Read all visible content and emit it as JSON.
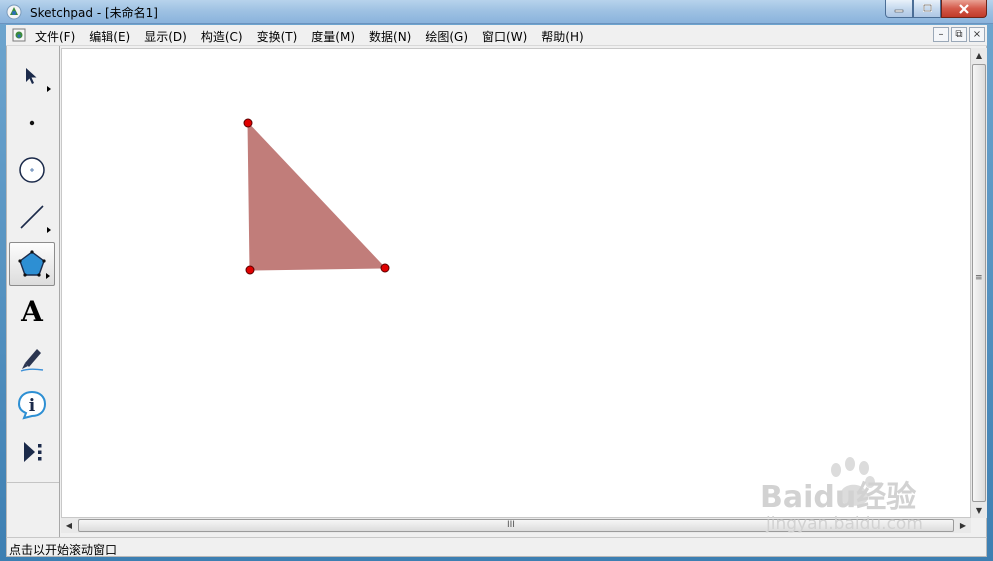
{
  "window": {
    "title": "Sketchpad - [未命名1]",
    "icon": "sketchpad-app-icon"
  },
  "caption_buttons": {
    "minimize": "minimize-icon",
    "maximize": "restore-icon",
    "close": "close-icon"
  },
  "menubar": {
    "items": [
      {
        "label": "文件(F)"
      },
      {
        "label": "编辑(E)"
      },
      {
        "label": "显示(D)"
      },
      {
        "label": "构造(C)"
      },
      {
        "label": "变换(T)"
      },
      {
        "label": "度量(M)"
      },
      {
        "label": "数据(N)"
      },
      {
        "label": "绘图(G)"
      },
      {
        "label": "窗口(W)"
      },
      {
        "label": "帮助(H)"
      }
    ],
    "mdi_buttons": {
      "minimize": "–",
      "restore": "⧉",
      "close": "×"
    }
  },
  "toolbox": {
    "tools": [
      {
        "name": "arrow-select-tool",
        "icon": "arrow-icon",
        "has_submenu": true,
        "active": false
      },
      {
        "name": "point-tool",
        "icon": "point-icon",
        "has_submenu": false,
        "active": false
      },
      {
        "name": "compass-tool",
        "icon": "circle-icon",
        "has_submenu": false,
        "active": false
      },
      {
        "name": "straightedge-tool",
        "icon": "segment-icon",
        "has_submenu": true,
        "active": false
      },
      {
        "name": "polygon-tool",
        "icon": "pentagon-icon",
        "has_submenu": true,
        "active": true
      },
      {
        "name": "text-tool",
        "icon": "text-A-icon",
        "label": "A",
        "has_submenu": false,
        "active": false
      },
      {
        "name": "marker-tool",
        "icon": "marker-pen-icon",
        "has_submenu": false,
        "active": false
      },
      {
        "name": "information-tool",
        "icon": "info-icon",
        "label": "i",
        "has_submenu": false,
        "active": false
      },
      {
        "name": "custom-tool",
        "icon": "custom-tools-icon",
        "has_submenu": false,
        "active": false
      }
    ]
  },
  "canvas": {
    "triangle": {
      "fill": "#c17d7a",
      "vertex_color": "#e00000",
      "vertices": [
        "top-vertex",
        "bottom-left-vertex",
        "bottom-right-vertex"
      ]
    }
  },
  "scrollbars": {
    "vertical_grip": "≡",
    "horizontal_grip": "III"
  },
  "statusbar": {
    "text": "点击以开始滚动窗口"
  },
  "watermark": {
    "logo": "baidu-jingyan-logo",
    "brand": "Baidu经验",
    "url": "jingyan.baidu.com",
    "color": "#d2d2d2"
  }
}
